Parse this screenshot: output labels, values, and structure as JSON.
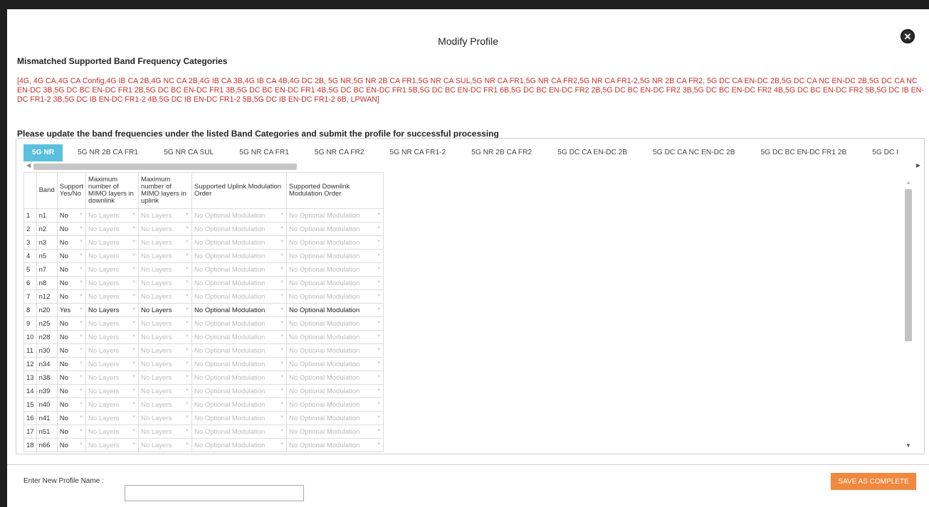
{
  "dialog": {
    "title": "Modify Profile",
    "close_icon": "close-icon"
  },
  "mismatch": {
    "heading": "Mismatched Supported Band Frequency Categories",
    "list": "[4G, 4G CA,4G CA Config,4G IB CA 2B,4G NC CA 2B,4G IB CA 3B,4G IB CA 4B,4G DC 2B, 5G NR,5G NR 2B CA FR1,5G NR CA SUL,5G NR CA FR1,5G NR CA FR2,5G NR CA FR1-2,5G NR 2B CA FR2, 5G DC CA EN-DC 2B,5G DC CA NC EN-DC 2B,5G DC CA NC EN-DC 3B,5G DC BC EN-DC FR1 2B,5G DC BC EN-DC FR1 3B,5G DC BC EN-DC FR1 4B,5G DC BC EN-DC FR1 5B,5G DC BC EN-DC FR1 6B,5G DC BC EN-DC FR2 2B,5G DC BC EN-DC FR2 3B,5G DC BC EN-DC FR2 4B,5G DC BC EN-DC FR2 5B,5G DC IB EN-DC FR1-2 3B,5G DC IB EN-DC FR1-2 4B,5G DC IB EN-DC FR1-2 5B,5G DC IB EN-DC FR1-2 6B, LPWAN]"
  },
  "instruction": "Please update the band frequencies under the listed Band Categories and submit the profile for successful processing",
  "tabs": [
    {
      "label": "5G NR",
      "active": true
    },
    {
      "label": "5G NR 2B CA FR1"
    },
    {
      "label": "5G NR CA SUL"
    },
    {
      "label": "5G NR CA FR1"
    },
    {
      "label": "5G NR CA FR2"
    },
    {
      "label": "5G NR CA FR1-2"
    },
    {
      "label": "5G NR 2B CA FR2"
    },
    {
      "label": "5G DC CA EN-DC 2B"
    },
    {
      "label": "5G DC CA NC EN-DC 2B"
    },
    {
      "label": "5G DC BC EN-DC FR1 2B"
    },
    {
      "label": "5G DC I"
    }
  ],
  "table": {
    "headers": [
      "",
      "Band",
      "Support Yes/No",
      "Maximum number of MIMO layers in downlink",
      "Maximum number of MIMO layers in uplink",
      "Supported Uplink Modulation Order",
      "Supported Downlink Modulation Order"
    ],
    "rows": [
      {
        "n": "1",
        "band": "n1",
        "support": "No",
        "dl": "No Layers",
        "ul": "No Layers",
        "ulmod": "No Optional Modulation",
        "dlmod": "No Optional Modulation"
      },
      {
        "n": "2",
        "band": "n2",
        "support": "No",
        "dl": "No Layers",
        "ul": "No Layers",
        "ulmod": "No Optional Modulation",
        "dlmod": "No Optional Modulation"
      },
      {
        "n": "3",
        "band": "n3",
        "support": "No",
        "dl": "No Layers",
        "ul": "No Layers",
        "ulmod": "No Optional Modulation",
        "dlmod": "No Optional Modulation"
      },
      {
        "n": "4",
        "band": "n5",
        "support": "No",
        "dl": "No Layers",
        "ul": "No Layers",
        "ulmod": "No Optional Modulation",
        "dlmod": "No Optional Modulation"
      },
      {
        "n": "5",
        "band": "n7",
        "support": "No",
        "dl": "No Layers",
        "ul": "No Layers",
        "ulmod": "No Optional Modulation",
        "dlmod": "No Optional Modulation"
      },
      {
        "n": "6",
        "band": "n8",
        "support": "No",
        "dl": "No Layers",
        "ul": "No Layers",
        "ulmod": "No Optional Modulation",
        "dlmod": "No Optional Modulation"
      },
      {
        "n": "7",
        "band": "n12",
        "support": "No",
        "dl": "No Layers",
        "ul": "No Layers",
        "ulmod": "No Optional Modulation",
        "dlmod": "No Optional Modulation"
      },
      {
        "n": "8",
        "band": "n20",
        "support": "Yes",
        "dl": "No Layers",
        "ul": "No Layers",
        "ulmod": "No Optional Modulation",
        "dlmod": "No Optional Modulation",
        "enabled": true
      },
      {
        "n": "9",
        "band": "n25",
        "support": "No",
        "dl": "No Layers",
        "ul": "No Layers",
        "ulmod": "No Optional Modulation",
        "dlmod": "No Optional Modulation"
      },
      {
        "n": "10",
        "band": "n28",
        "support": "No",
        "dl": "No Layers",
        "ul": "No Layers",
        "ulmod": "No Optional Modulation",
        "dlmod": "No Optional Modulation"
      },
      {
        "n": "11",
        "band": "n30",
        "support": "No",
        "dl": "No Layers",
        "ul": "No Layers",
        "ulmod": "No Optional Modulation",
        "dlmod": "No Optional Modulation"
      },
      {
        "n": "12",
        "band": "n34",
        "support": "No",
        "dl": "No Layers",
        "ul": "No Layers",
        "ulmod": "No Optional Modulation",
        "dlmod": "No Optional Modulation"
      },
      {
        "n": "13",
        "band": "n38",
        "support": "No",
        "dl": "No Layers",
        "ul": "No Layers",
        "ulmod": "No Optional Modulation",
        "dlmod": "No Optional Modulation"
      },
      {
        "n": "14",
        "band": "n39",
        "support": "No",
        "dl": "No Layers",
        "ul": "No Layers",
        "ulmod": "No Optional Modulation",
        "dlmod": "No Optional Modulation"
      },
      {
        "n": "15",
        "band": "n40",
        "support": "No",
        "dl": "No Layers",
        "ul": "No Layers",
        "ulmod": "No Optional Modulation",
        "dlmod": "No Optional Modulation"
      },
      {
        "n": "16",
        "band": "n41",
        "support": "No",
        "dl": "No Layers",
        "ul": "No Layers",
        "ulmod": "No Optional Modulation",
        "dlmod": "No Optional Modulation"
      },
      {
        "n": "17",
        "band": "n51",
        "support": "No",
        "dl": "No Layers",
        "ul": "No Layers",
        "ulmod": "No Optional Modulation",
        "dlmod": "No Optional Modulation"
      },
      {
        "n": "18",
        "band": "n66",
        "support": "No",
        "dl": "No Layers",
        "ul": "No Layers",
        "ulmod": "No Optional Modulation",
        "dlmod": "No Optional Modulation"
      }
    ]
  },
  "footer": {
    "name_label": "Enter New Profile Name :",
    "name_value": "",
    "save_label": "SAVE AS COMPLETE"
  },
  "colors": {
    "accent_tab": "#5bc0de",
    "save_button": "#f0883e",
    "mismatch_text": "#c9302c"
  }
}
